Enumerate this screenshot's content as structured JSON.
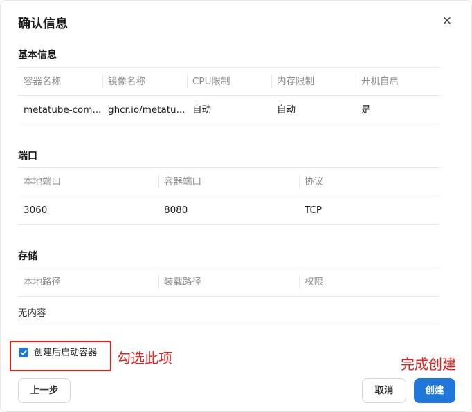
{
  "dialog": {
    "title": "确认信息",
    "close_glyph": "×"
  },
  "basic": {
    "title": "基本信息",
    "headers": [
      "容器名称",
      "镜像名称",
      "CPU限制",
      "内存限制",
      "开机自启"
    ],
    "values": [
      "metatube-com...",
      "ghcr.io/metatu...",
      "自动",
      "自动",
      "是"
    ]
  },
  "ports": {
    "title": "端口",
    "headers": [
      "本地端口",
      "容器端口",
      "协议"
    ],
    "values": [
      "3060",
      "8080",
      "TCP"
    ]
  },
  "storage": {
    "title": "存储",
    "headers": [
      "本地路径",
      "装载路径",
      "权限"
    ],
    "empty_text": "无内容"
  },
  "options": {
    "autostart_label": "创建后启动容器",
    "autostart_checked": true
  },
  "annotations": {
    "check_hint": "勾选此项",
    "finish_hint": "完成创建",
    "color": "#e0201b"
  },
  "footer": {
    "prev_label": "上一步",
    "cancel_label": "取消",
    "create_label": "创建"
  },
  "colors": {
    "primary": "#2176d9"
  }
}
